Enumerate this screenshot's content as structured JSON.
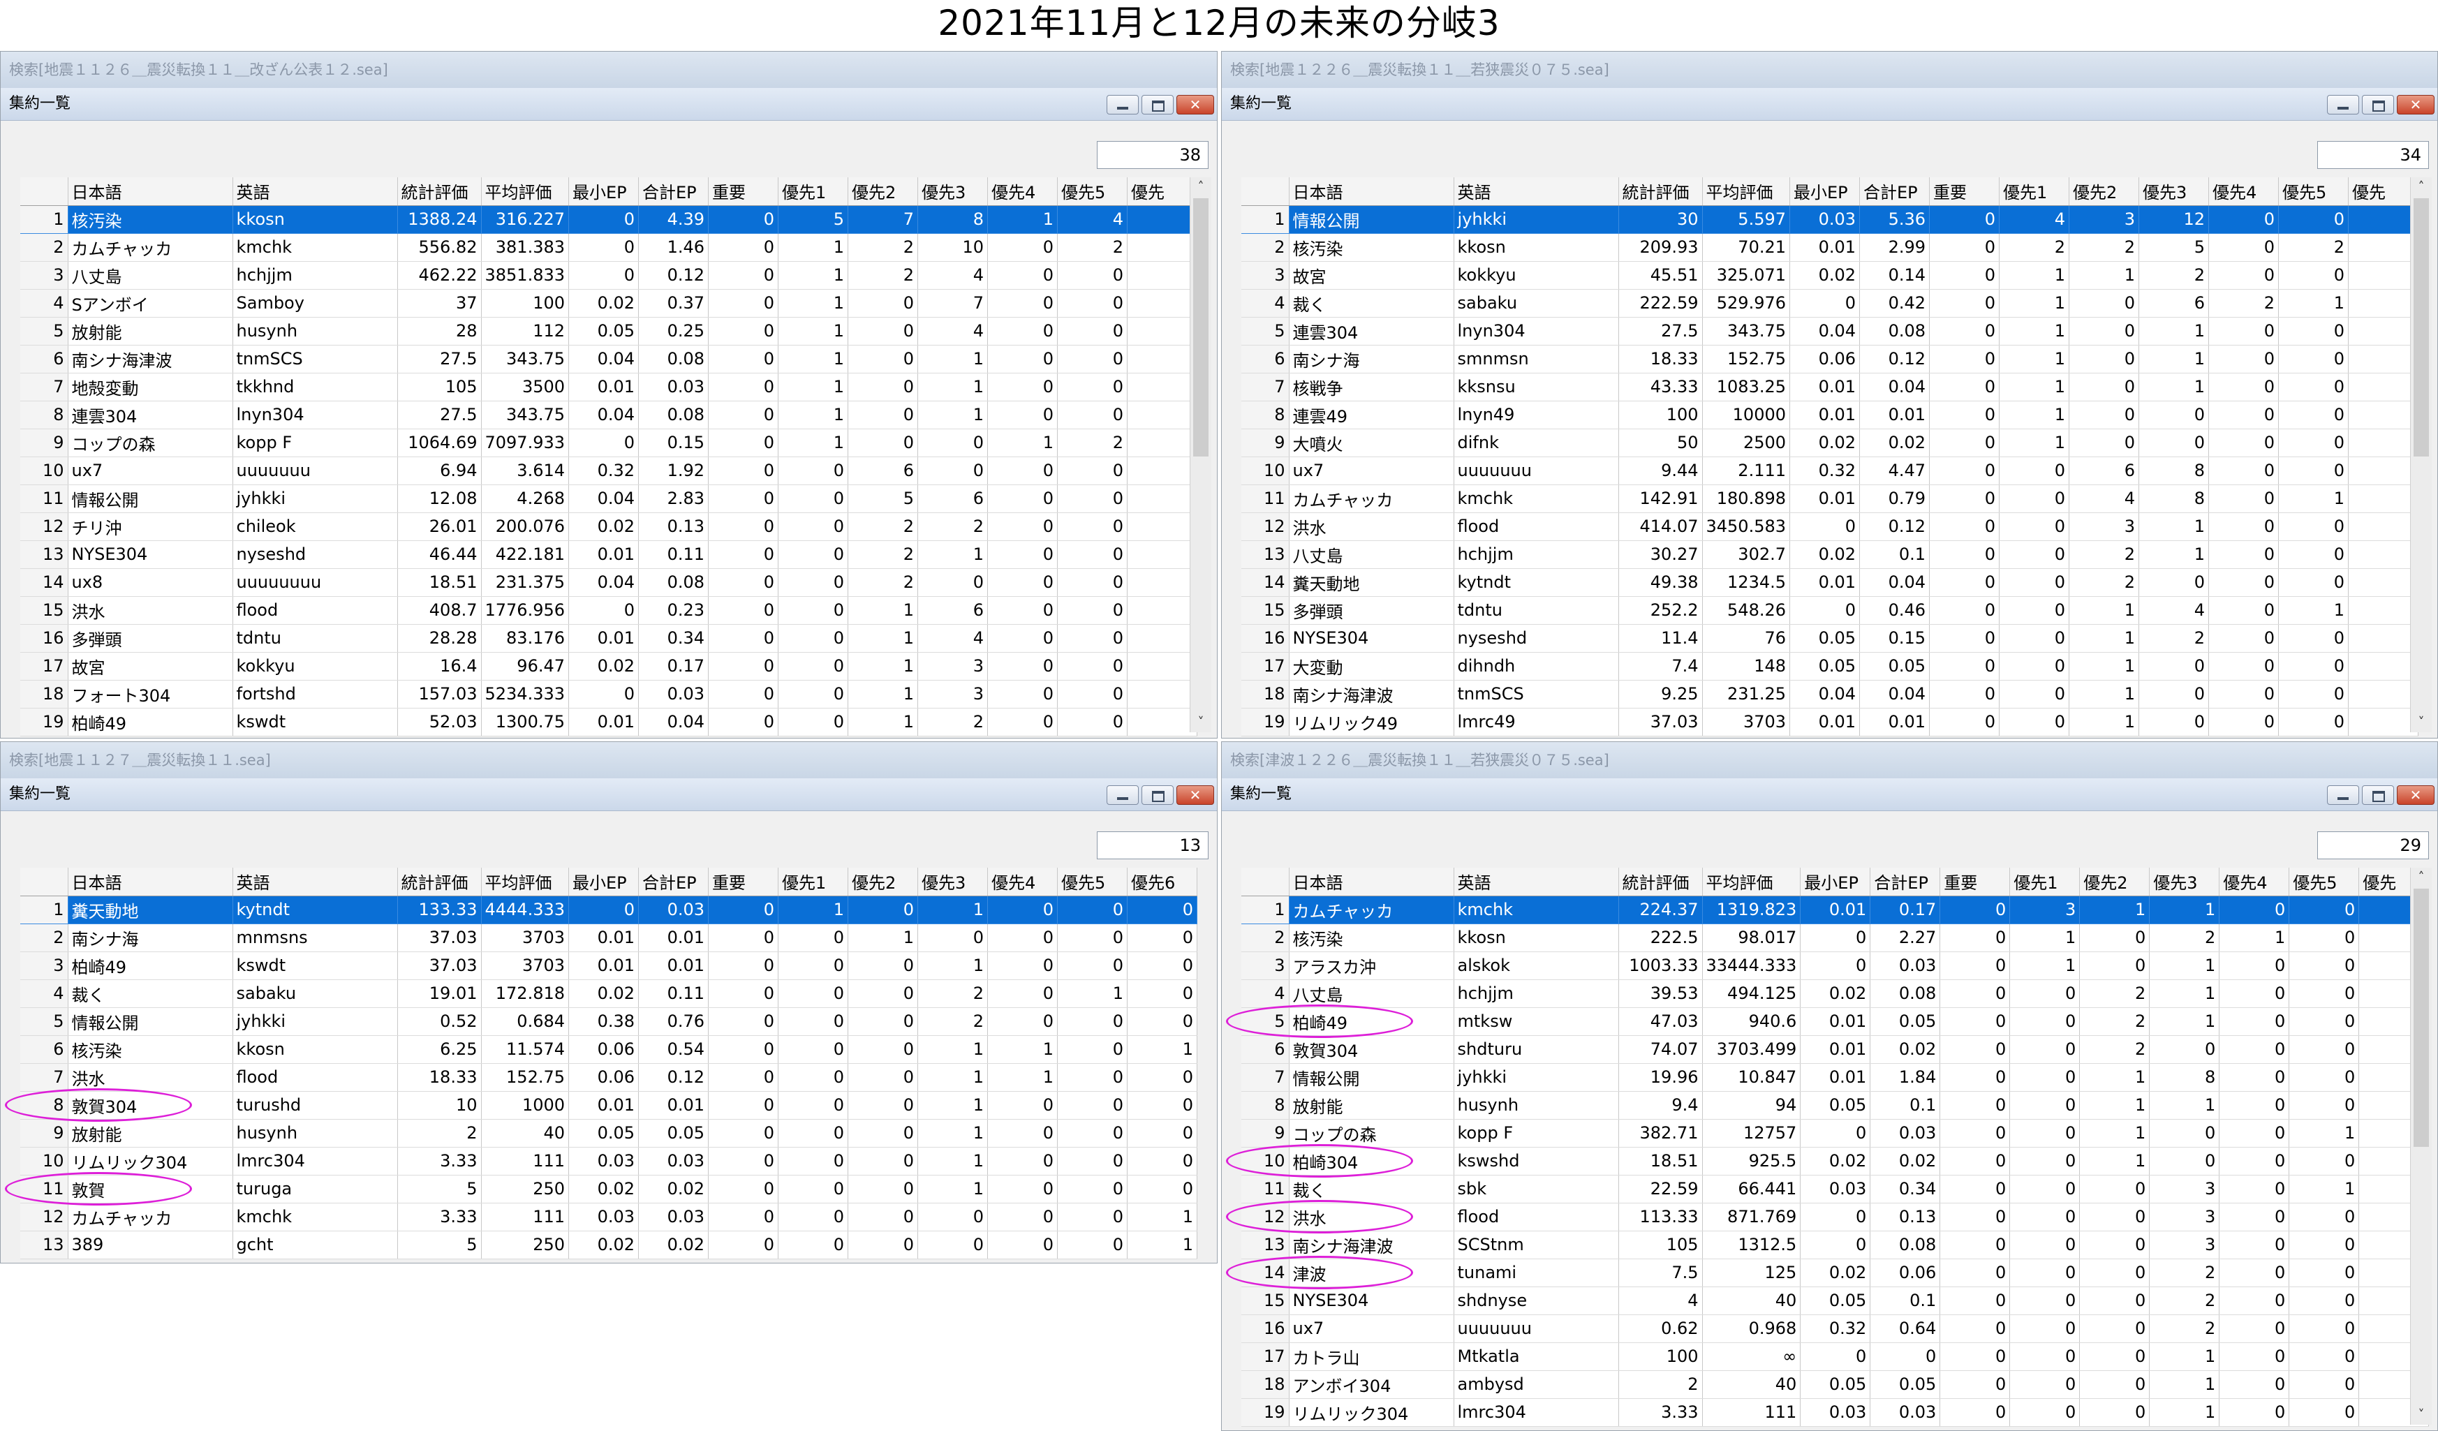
{
  "page_title": "2021年11月と12月の未来の分岐3",
  "panels": [
    {
      "search_title": "検索[地震１１２６＿震災転換１１＿改ざん公表１２.sea]",
      "window_title": "集約一覧",
      "count": "38",
      "columns": [
        "",
        "日本語",
        "英語",
        "統計評価",
        "平均評価",
        "最小EP",
        "合計EP",
        "重要",
        "優先1",
        "優先2",
        "優先3",
        "優先4",
        "優先5",
        "優先"
      ],
      "rows": [
        [
          "1",
          "核汚染",
          "kkosn",
          "1388.24",
          "316.227",
          "0",
          "4.39",
          "0",
          "5",
          "7",
          "8",
          "1",
          "4"
        ],
        [
          "2",
          "カムチャッカ",
          "kmchk",
          "556.82",
          "381.383",
          "0",
          "1.46",
          "0",
          "1",
          "2",
          "10",
          "0",
          "2"
        ],
        [
          "3",
          "八丈島",
          "hchjjm",
          "462.22",
          "3851.833",
          "0",
          "0.12",
          "0",
          "1",
          "2",
          "4",
          "0",
          "0"
        ],
        [
          "4",
          "Sアンボイ",
          "Samboy",
          "37",
          "100",
          "0.02",
          "0.37",
          "0",
          "1",
          "0",
          "7",
          "0",
          "0"
        ],
        [
          "5",
          "放射能",
          "husynh",
          "28",
          "112",
          "0.05",
          "0.25",
          "0",
          "1",
          "0",
          "4",
          "0",
          "0"
        ],
        [
          "6",
          "南シナ海津波",
          "tnmSCS",
          "27.5",
          "343.75",
          "0.04",
          "0.08",
          "0",
          "1",
          "0",
          "1",
          "0",
          "0"
        ],
        [
          "7",
          "地殻変動",
          "tkkhnd",
          "105",
          "3500",
          "0.01",
          "0.03",
          "0",
          "1",
          "0",
          "1",
          "0",
          "0"
        ],
        [
          "8",
          "連雲304",
          "lnyn304",
          "27.5",
          "343.75",
          "0.04",
          "0.08",
          "0",
          "1",
          "0",
          "1",
          "0",
          "0"
        ],
        [
          "9",
          "コップの森",
          "kopp F",
          "1064.69",
          "7097.933",
          "0",
          "0.15",
          "0",
          "1",
          "0",
          "0",
          "1",
          "2"
        ],
        [
          "10",
          "ux7",
          "uuuuuuu",
          "6.94",
          "3.614",
          "0.32",
          "1.92",
          "0",
          "0",
          "6",
          "0",
          "0",
          "0"
        ],
        [
          "11",
          "情報公開",
          "jyhkki",
          "12.08",
          "4.268",
          "0.04",
          "2.83",
          "0",
          "0",
          "5",
          "6",
          "0",
          "0"
        ],
        [
          "12",
          "チリ沖",
          "chileok",
          "26.01",
          "200.076",
          "0.02",
          "0.13",
          "0",
          "0",
          "2",
          "2",
          "0",
          "0"
        ],
        [
          "13",
          "NYSE304",
          "nyseshd",
          "46.44",
          "422.181",
          "0.01",
          "0.11",
          "0",
          "0",
          "2",
          "1",
          "0",
          "0"
        ],
        [
          "14",
          "ux8",
          "uuuuuuuu",
          "18.51",
          "231.375",
          "0.04",
          "0.08",
          "0",
          "0",
          "2",
          "0",
          "0",
          "0"
        ],
        [
          "15",
          "洪水",
          "flood",
          "408.7",
          "1776.956",
          "0",
          "0.23",
          "0",
          "0",
          "1",
          "6",
          "0",
          "0"
        ],
        [
          "16",
          "多弾頭",
          "tdntu",
          "28.28",
          "83.176",
          "0.01",
          "0.34",
          "0",
          "0",
          "1",
          "4",
          "0",
          "0"
        ],
        [
          "17",
          "故宮",
          "kokkyu",
          "16.4",
          "96.47",
          "0.02",
          "0.17",
          "0",
          "0",
          "1",
          "3",
          "0",
          "0"
        ],
        [
          "18",
          "フォート304",
          "fortshd",
          "157.03",
          "5234.333",
          "0",
          "0.03",
          "0",
          "0",
          "1",
          "3",
          "0",
          "0"
        ],
        [
          "19",
          "柏崎49",
          "kswdt",
          "52.03",
          "1300.75",
          "0.01",
          "0.04",
          "0",
          "0",
          "1",
          "2",
          "0",
          "0"
        ]
      ]
    },
    {
      "search_title": "検索[地震１２２６＿震災転換１１＿若狭震災０７５.sea]",
      "window_title": "集約一覧",
      "count": "34",
      "columns": [
        "",
        "日本語",
        "英語",
        "統計評価",
        "平均評価",
        "最小EP",
        "合計EP",
        "重要",
        "優先1",
        "優先2",
        "優先3",
        "優先4",
        "優先5",
        "優先"
      ],
      "rows": [
        [
          "1",
          "情報公開",
          "jyhkki",
          "30",
          "5.597",
          "0.03",
          "5.36",
          "0",
          "4",
          "3",
          "12",
          "0",
          "0"
        ],
        [
          "2",
          "核汚染",
          "kkosn",
          "209.93",
          "70.21",
          "0.01",
          "2.99",
          "0",
          "2",
          "2",
          "5",
          "0",
          "2"
        ],
        [
          "3",
          "故宮",
          "kokkyu",
          "45.51",
          "325.071",
          "0.02",
          "0.14",
          "0",
          "1",
          "1",
          "2",
          "0",
          "0"
        ],
        [
          "4",
          "裁く",
          "sabaku",
          "222.59",
          "529.976",
          "0",
          "0.42",
          "0",
          "1",
          "0",
          "6",
          "2",
          "1"
        ],
        [
          "5",
          "連雲304",
          "lnyn304",
          "27.5",
          "343.75",
          "0.04",
          "0.08",
          "0",
          "1",
          "0",
          "1",
          "0",
          "0"
        ],
        [
          "6",
          "南シナ海",
          "smnmsn",
          "18.33",
          "152.75",
          "0.06",
          "0.12",
          "0",
          "1",
          "0",
          "1",
          "0",
          "0"
        ],
        [
          "7",
          "核戦争",
          "kksnsu",
          "43.33",
          "1083.25",
          "0.01",
          "0.04",
          "0",
          "1",
          "0",
          "1",
          "0",
          "0"
        ],
        [
          "8",
          "連雲49",
          "lnyn49",
          "100",
          "10000",
          "0.01",
          "0.01",
          "0",
          "1",
          "0",
          "0",
          "0",
          "0"
        ],
        [
          "9",
          "大噴火",
          "difnk",
          "50",
          "2500",
          "0.02",
          "0.02",
          "0",
          "1",
          "0",
          "0",
          "0",
          "0"
        ],
        [
          "10",
          "ux7",
          "uuuuuuu",
          "9.44",
          "2.111",
          "0.32",
          "4.47",
          "0",
          "0",
          "6",
          "8",
          "0",
          "0"
        ],
        [
          "11",
          "カムチャッカ",
          "kmchk",
          "142.91",
          "180.898",
          "0.01",
          "0.79",
          "0",
          "0",
          "4",
          "8",
          "0",
          "1"
        ],
        [
          "12",
          "洪水",
          "flood",
          "414.07",
          "3450.583",
          "0",
          "0.12",
          "0",
          "0",
          "3",
          "1",
          "0",
          "0"
        ],
        [
          "13",
          "八丈島",
          "hchjjm",
          "30.27",
          "302.7",
          "0.02",
          "0.1",
          "0",
          "0",
          "2",
          "1",
          "0",
          "0"
        ],
        [
          "14",
          "糞天動地",
          "kytndt",
          "49.38",
          "1234.5",
          "0.01",
          "0.04",
          "0",
          "0",
          "2",
          "0",
          "0",
          "0"
        ],
        [
          "15",
          "多弾頭",
          "tdntu",
          "252.2",
          "548.26",
          "0",
          "0.46",
          "0",
          "0",
          "1",
          "4",
          "0",
          "1"
        ],
        [
          "16",
          "NYSE304",
          "nyseshd",
          "11.4",
          "76",
          "0.05",
          "0.15",
          "0",
          "0",
          "1",
          "2",
          "0",
          "0"
        ],
        [
          "17",
          "大変動",
          "dihndh",
          "7.4",
          "148",
          "0.05",
          "0.05",
          "0",
          "0",
          "1",
          "0",
          "0",
          "0"
        ],
        [
          "18",
          "南シナ海津波",
          "tnmSCS",
          "9.25",
          "231.25",
          "0.04",
          "0.04",
          "0",
          "0",
          "1",
          "0",
          "0",
          "0"
        ],
        [
          "19",
          "リムリック49",
          "lmrc49",
          "37.03",
          "3703",
          "0.01",
          "0.01",
          "0",
          "0",
          "1",
          "0",
          "0",
          "0"
        ]
      ]
    },
    {
      "search_title": "検索[地震１１２７＿震災転換１１.sea]",
      "window_title": "集約一覧",
      "count": "13",
      "columns": [
        "",
        "日本語",
        "英語",
        "統計評価",
        "平均評価",
        "最小EP",
        "合計EP",
        "重要",
        "優先1",
        "優先2",
        "優先3",
        "優先4",
        "優先5",
        "優先6"
      ],
      "rows": [
        [
          "1",
          "糞天動地",
          "kytndt",
          "133.33",
          "4444.333",
          "0",
          "0.03",
          "0",
          "1",
          "0",
          "1",
          "0",
          "0",
          "0"
        ],
        [
          "2",
          "南シナ海",
          "mnmsns",
          "37.03",
          "3703",
          "0.01",
          "0.01",
          "0",
          "0",
          "1",
          "0",
          "0",
          "0",
          "0"
        ],
        [
          "3",
          "柏崎49",
          "kswdt",
          "37.03",
          "3703",
          "0.01",
          "0.01",
          "0",
          "0",
          "0",
          "1",
          "0",
          "0",
          "0"
        ],
        [
          "4",
          "裁く",
          "sabaku",
          "19.01",
          "172.818",
          "0.02",
          "0.11",
          "0",
          "0",
          "0",
          "2",
          "0",
          "1",
          "0"
        ],
        [
          "5",
          "情報公開",
          "jyhkki",
          "0.52",
          "0.684",
          "0.38",
          "0.76",
          "0",
          "0",
          "0",
          "2",
          "0",
          "0",
          "0"
        ],
        [
          "6",
          "核汚染",
          "kkosn",
          "6.25",
          "11.574",
          "0.06",
          "0.54",
          "0",
          "0",
          "0",
          "1",
          "1",
          "0",
          "1"
        ],
        [
          "7",
          "洪水",
          "flood",
          "18.33",
          "152.75",
          "0.06",
          "0.12",
          "0",
          "0",
          "0",
          "1",
          "1",
          "0",
          "0"
        ],
        [
          "8",
          "敦賀304",
          "turushd",
          "10",
          "1000",
          "0.01",
          "0.01",
          "0",
          "0",
          "0",
          "1",
          "0",
          "0",
          "0"
        ],
        [
          "9",
          "放射能",
          "husynh",
          "2",
          "40",
          "0.05",
          "0.05",
          "0",
          "0",
          "0",
          "1",
          "0",
          "0",
          "0"
        ],
        [
          "10",
          "リムリック304",
          "lmrc304",
          "3.33",
          "111",
          "0.03",
          "0.03",
          "0",
          "0",
          "0",
          "1",
          "0",
          "0",
          "0"
        ],
        [
          "11",
          "敦賀",
          "turuga",
          "5",
          "250",
          "0.02",
          "0.02",
          "0",
          "0",
          "0",
          "1",
          "0",
          "0",
          "0"
        ],
        [
          "12",
          "カムチャッカ",
          "kmchk",
          "3.33",
          "111",
          "0.03",
          "0.03",
          "0",
          "0",
          "0",
          "0",
          "0",
          "0",
          "1"
        ],
        [
          "13",
          "389",
          "gcht",
          "5",
          "250",
          "0.02",
          "0.02",
          "0",
          "0",
          "0",
          "0",
          "0",
          "0",
          "1"
        ]
      ]
    },
    {
      "search_title": "検索[津波１２２６＿震災転換１１＿若狭震災０７５.sea]",
      "window_title": "集約一覧",
      "count": "29",
      "columns": [
        "",
        "日本語",
        "英語",
        "統計評価",
        "平均評価",
        "最小EP",
        "合計EP",
        "重要",
        "優先1",
        "優先2",
        "優先3",
        "優先4",
        "優先5",
        "優先"
      ],
      "rows": [
        [
          "1",
          "カムチャッカ",
          "kmchk",
          "224.37",
          "1319.823",
          "0.01",
          "0.17",
          "0",
          "3",
          "1",
          "1",
          "0",
          "0"
        ],
        [
          "2",
          "核汚染",
          "kkosn",
          "222.5",
          "98.017",
          "0",
          "2.27",
          "0",
          "1",
          "0",
          "2",
          "1",
          "0"
        ],
        [
          "3",
          "アラスカ沖",
          "alskok",
          "1003.33",
          "33444.333",
          "0",
          "0.03",
          "0",
          "1",
          "0",
          "1",
          "0",
          "0"
        ],
        [
          "4",
          "八丈島",
          "hchjjm",
          "39.53",
          "494.125",
          "0.02",
          "0.08",
          "0",
          "0",
          "2",
          "1",
          "0",
          "0"
        ],
        [
          "5",
          "柏崎49",
          "mtksw",
          "47.03",
          "940.6",
          "0.01",
          "0.05",
          "0",
          "0",
          "2",
          "1",
          "0",
          "0"
        ],
        [
          "6",
          "敦賀304",
          "shdturu",
          "74.07",
          "3703.499",
          "0.01",
          "0.02",
          "0",
          "0",
          "2",
          "0",
          "0",
          "0"
        ],
        [
          "7",
          "情報公開",
          "jyhkki",
          "19.96",
          "10.847",
          "0.01",
          "1.84",
          "0",
          "0",
          "1",
          "8",
          "0",
          "0"
        ],
        [
          "8",
          "放射能",
          "husynh",
          "9.4",
          "94",
          "0.05",
          "0.1",
          "0",
          "0",
          "1",
          "1",
          "0",
          "0"
        ],
        [
          "9",
          "コップの森",
          "kopp F",
          "382.71",
          "12757",
          "0",
          "0.03",
          "0",
          "0",
          "1",
          "0",
          "0",
          "1"
        ],
        [
          "10",
          "柏崎304",
          "kswshd",
          "18.51",
          "925.5",
          "0.02",
          "0.02",
          "0",
          "0",
          "1",
          "0",
          "0",
          "0"
        ],
        [
          "11",
          "裁く",
          "sbk",
          "22.59",
          "66.441",
          "0.03",
          "0.34",
          "0",
          "0",
          "0",
          "3",
          "0",
          "1"
        ],
        [
          "12",
          "洪水",
          "flood",
          "113.33",
          "871.769",
          "0",
          "0.13",
          "0",
          "0",
          "0",
          "3",
          "0",
          "0"
        ],
        [
          "13",
          "南シナ海津波",
          "SCStnm",
          "105",
          "1312.5",
          "0",
          "0.08",
          "0",
          "0",
          "0",
          "3",
          "0",
          "0"
        ],
        [
          "14",
          "津波",
          "tunami",
          "7.5",
          "125",
          "0.02",
          "0.06",
          "0",
          "0",
          "0",
          "2",
          "0",
          "0"
        ],
        [
          "15",
          "NYSE304",
          "shdnyse",
          "4",
          "40",
          "0.05",
          "0.1",
          "0",
          "0",
          "0",
          "2",
          "0",
          "0"
        ],
        [
          "16",
          "ux7",
          "uuuuuuu",
          "0.62",
          "0.968",
          "0.32",
          "0.64",
          "0",
          "0",
          "0",
          "2",
          "0",
          "0"
        ],
        [
          "17",
          "カトラ山",
          "Mtkatla",
          "100",
          "∞",
          "0",
          "0",
          "0",
          "0",
          "0",
          "1",
          "0",
          "0"
        ],
        [
          "18",
          "アンボイ304",
          "ambysd",
          "2",
          "40",
          "0.05",
          "0.05",
          "0",
          "0",
          "0",
          "1",
          "0",
          "0"
        ],
        [
          "19",
          "リムリック304",
          "lmrc304",
          "3.33",
          "111",
          "0.03",
          "0.03",
          "0",
          "0",
          "0",
          "1",
          "0",
          "0"
        ]
      ]
    }
  ],
  "annotation_color": "#dd1fd8"
}
